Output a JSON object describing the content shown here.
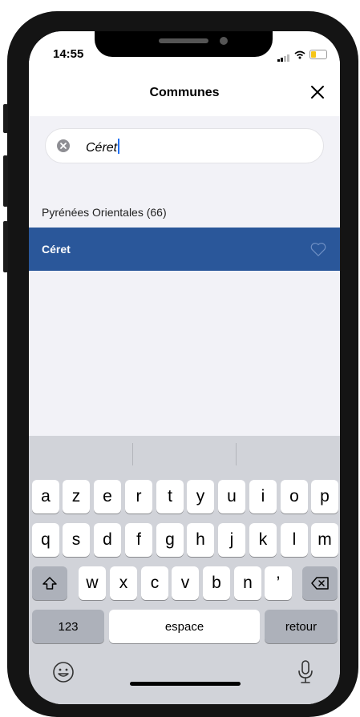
{
  "status_bar": {
    "time": "14:55"
  },
  "navbar": {
    "title": "Communes"
  },
  "search": {
    "value": "Céret"
  },
  "results": {
    "section_header": "Pyrénées Orientales (66)",
    "items": [
      {
        "label": "Céret"
      }
    ]
  },
  "keyboard": {
    "row1": [
      "a",
      "z",
      "e",
      "r",
      "t",
      "y",
      "u",
      "i",
      "o",
      "p"
    ],
    "row2": [
      "q",
      "s",
      "d",
      "f",
      "g",
      "h",
      "j",
      "k",
      "l",
      "m"
    ],
    "row3": [
      "w",
      "x",
      "c",
      "v",
      "b",
      "n",
      "’"
    ],
    "numbers_label": "123",
    "space_label": "espace",
    "return_label": "retour"
  },
  "colors": {
    "selected_row": "#2a579a",
    "caret": "#1f6ff2",
    "keyboard_bg": "#d1d3d9"
  }
}
